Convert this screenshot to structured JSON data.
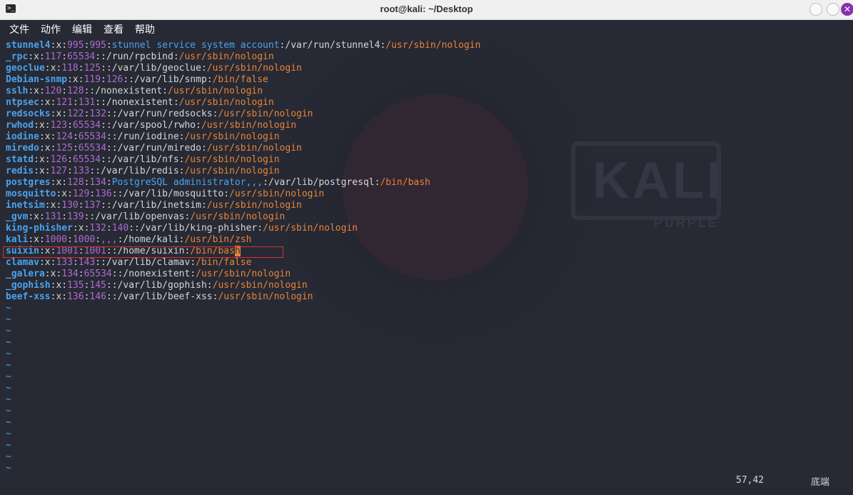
{
  "window": {
    "title": "root@kali: ~/Desktop",
    "icon": "terminal-icon"
  },
  "menu": [
    "文件",
    "动作",
    "编辑",
    "查看",
    "帮助"
  ],
  "lines": [
    {
      "user": "stunnel4",
      "uid": "995",
      "gid": "995",
      "gecos": "stunnel service system account",
      "home": "/var/run/stunnel4",
      "shell": "/usr/sbin/nologin"
    },
    {
      "user": "_rpc",
      "uid": "117",
      "gid": "65534",
      "gecos": "",
      "home": "/run/rpcbind",
      "shell": "/usr/sbin/nologin"
    },
    {
      "user": "geoclue",
      "uid": "118",
      "gid": "125",
      "gecos": "",
      "home": "/var/lib/geoclue",
      "shell": "/usr/sbin/nologin"
    },
    {
      "user": "Debian-snmp",
      "uid": "119",
      "gid": "126",
      "gecos": "",
      "home": "/var/lib/snmp",
      "shell": "/bin/false"
    },
    {
      "user": "sslh",
      "uid": "120",
      "gid": "128",
      "gecos": "",
      "home": "/nonexistent",
      "shell": "/usr/sbin/nologin"
    },
    {
      "user": "ntpsec",
      "uid": "121",
      "gid": "131",
      "gecos": "",
      "home": "/nonexistent",
      "shell": "/usr/sbin/nologin"
    },
    {
      "user": "redsocks",
      "uid": "122",
      "gid": "132",
      "gecos": "",
      "home": "/var/run/redsocks",
      "shell": "/usr/sbin/nologin"
    },
    {
      "user": "rwhod",
      "uid": "123",
      "gid": "65534",
      "gecos": "",
      "home": "/var/spool/rwho",
      "shell": "/usr/sbin/nologin"
    },
    {
      "user": "iodine",
      "uid": "124",
      "gid": "65534",
      "gecos": "",
      "home": "/run/iodine",
      "shell": "/usr/sbin/nologin"
    },
    {
      "user": "miredo",
      "uid": "125",
      "gid": "65534",
      "gecos": "",
      "home": "/var/run/miredo",
      "shell": "/usr/sbin/nologin"
    },
    {
      "user": "statd",
      "uid": "126",
      "gid": "65534",
      "gecos": "",
      "home": "/var/lib/nfs",
      "shell": "/usr/sbin/nologin"
    },
    {
      "user": "redis",
      "uid": "127",
      "gid": "133",
      "gecos": "",
      "home": "/var/lib/redis",
      "shell": "/usr/sbin/nologin"
    },
    {
      "user": "postgres",
      "uid": "128",
      "gid": "134",
      "gecos": "PostgreSQL administrator,,,",
      "home": "/var/lib/postgresql",
      "shell": "/bin/bash"
    },
    {
      "user": "mosquitto",
      "uid": "129",
      "gid": "136",
      "gecos": "",
      "home": "/var/lib/mosquitto",
      "shell": "/usr/sbin/nologin"
    },
    {
      "user": "inetsim",
      "uid": "130",
      "gid": "137",
      "gecos": "",
      "home": "/var/lib/inetsim",
      "shell": "/usr/sbin/nologin"
    },
    {
      "user": "_gvm",
      "uid": "131",
      "gid": "139",
      "gecos": "",
      "home": "/var/lib/openvas",
      "shell": "/usr/sbin/nologin"
    },
    {
      "user": "king-phisher",
      "uid": "132",
      "gid": "140",
      "gecos": "",
      "home": "/var/lib/king-phisher",
      "shell": "/usr/sbin/nologin"
    },
    {
      "user": "kali",
      "uid": "1000",
      "gid": "1000",
      "gecos": ",,,",
      "home": "/home/kali",
      "shell": "/usr/bin/zsh"
    },
    {
      "user": "suixin",
      "uid": "1001",
      "gid": "1001",
      "gecos": "",
      "home": "/home/suixin",
      "shell": "/bin/bas",
      "cursor": "h",
      "highlight": true
    },
    {
      "user": "clamav",
      "uid": "133",
      "gid": "143",
      "gecos": "",
      "home": "/var/lib/clamav",
      "shell": "/bin/false"
    },
    {
      "user": "_galera",
      "uid": "134",
      "gid": "65534",
      "gecos": "",
      "home": "/nonexistent",
      "shell": "/usr/sbin/nologin"
    },
    {
      "user": "_gophish",
      "uid": "135",
      "gid": "145",
      "gecos": "",
      "home": "/var/lib/gophish",
      "shell": "/usr/sbin/nologin"
    },
    {
      "user": "beef-xss",
      "uid": "136",
      "gid": "146",
      "gecos": "",
      "home": "/var/lib/beef-xss",
      "shell": "/usr/sbin/nologin"
    }
  ],
  "tilde": "~",
  "tilde_count": 15,
  "status": {
    "position": "57,42",
    "scroll": "底端"
  },
  "watermark": {
    "brand": "KALI",
    "sub": "PURPLE"
  },
  "colors": {
    "background": "#272a34",
    "username": "#4aa3f0",
    "number": "#b06ad0",
    "shell_path": "#e8843a",
    "highlight_box": "#d33232",
    "close_button": "#8b2fb0"
  }
}
